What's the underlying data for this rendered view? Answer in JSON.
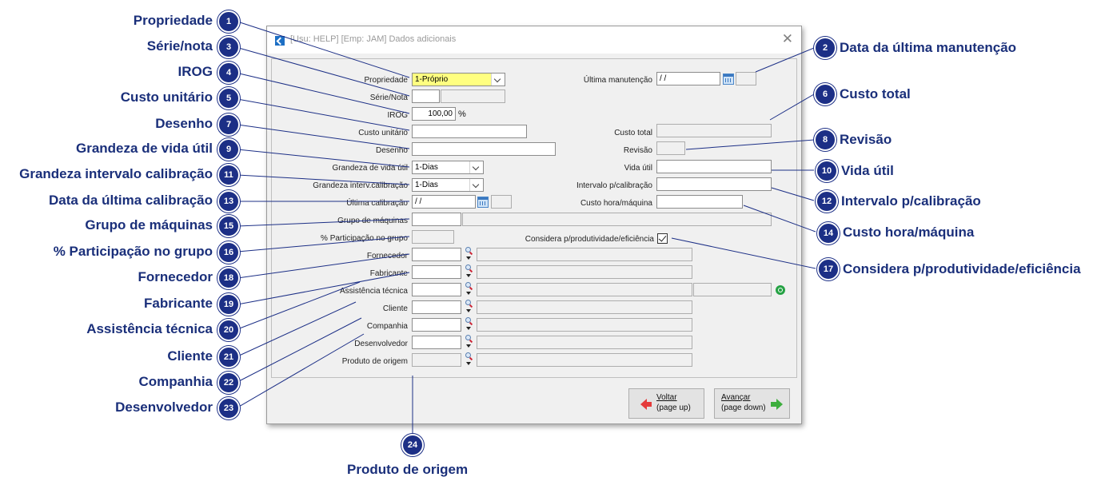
{
  "window": {
    "title": "[Usu: HELP] [Emp: JAM] Dados adicionais"
  },
  "form": {
    "propriedade": {
      "label": "Propriedade",
      "value": "1-Próprio"
    },
    "serie_nota": {
      "label": "Série/Nota",
      "value": "",
      "value2": ""
    },
    "irog": {
      "label": "IROG",
      "value": "100,00",
      "unit": "%"
    },
    "custo_unitario": {
      "label": "Custo unitário",
      "value": ""
    },
    "desenho": {
      "label": "Desenho",
      "value": ""
    },
    "grandeza_vida_util": {
      "label": "Grandeza de vida útil",
      "value": "1-Dias"
    },
    "grandeza_interv": {
      "label": "Grandeza interv.calibração",
      "value": "1-Dias"
    },
    "ultima_calibracao": {
      "label": "Última calibração",
      "value": " / /"
    },
    "grupo_maquinas": {
      "label": "Grupo de máquinas",
      "value": "",
      "desc": ""
    },
    "participacao_grupo": {
      "label": "% Participação no grupo",
      "value": ""
    },
    "fornecedor": {
      "label": "Fornecedor",
      "value": "",
      "desc": ""
    },
    "fabricante": {
      "label": "Fabricante",
      "value": "",
      "desc": ""
    },
    "assistencia_tecnica": {
      "label": "Assistência técnica",
      "value": "",
      "desc": "",
      "phone": ""
    },
    "cliente": {
      "label": "Cliente",
      "value": "",
      "desc": ""
    },
    "companhia": {
      "label": "Companhia",
      "value": "",
      "desc": ""
    },
    "desenvolvedor": {
      "label": "Desenvolvedor",
      "value": "",
      "desc": ""
    },
    "produto_origem": {
      "label": "Produto de origem",
      "value": "",
      "desc": ""
    },
    "ultima_manutencao": {
      "label": "Última manutenção",
      "value": " / /"
    },
    "custo_total": {
      "label": "Custo total",
      "value": ""
    },
    "revisao": {
      "label": "Revisão",
      "value": ""
    },
    "vida_util": {
      "label": "Vida útil",
      "value": ""
    },
    "intervalo_calibracao": {
      "label": "Intervalo p/calibração",
      "value": ""
    },
    "custo_hora_maquina": {
      "label": "Custo hora/máquina",
      "value": ""
    },
    "considera_produtividade": {
      "label": "Considera p/produtividade/eficiência",
      "checked": true
    }
  },
  "buttons": {
    "voltar": {
      "line1": "Voltar",
      "line2": "(page up)"
    },
    "avancar": {
      "line1": "Avançar",
      "line2": "(page down)"
    }
  },
  "annotations": {
    "a1": {
      "num": "1",
      "text": "Propriedade"
    },
    "a2": {
      "num": "2",
      "text": "Data da última manutenção"
    },
    "a3": {
      "num": "3",
      "text": "Série/nota"
    },
    "a4": {
      "num": "4",
      "text": "IROG"
    },
    "a5": {
      "num": "5",
      "text": "Custo unitário"
    },
    "a6": {
      "num": "6",
      "text": "Custo total"
    },
    "a7": {
      "num": "7",
      "text": "Desenho"
    },
    "a8": {
      "num": "8",
      "text": "Revisão"
    },
    "a9": {
      "num": "9",
      "text": "Grandeza de vida útil"
    },
    "a10": {
      "num": "10",
      "text": "Vida útil"
    },
    "a11": {
      "num": "11",
      "text": "Grandeza intervalo calibração"
    },
    "a12": {
      "num": "12",
      "text": "Intervalo p/calibração"
    },
    "a13": {
      "num": "13",
      "text": "Data da última calibração"
    },
    "a14": {
      "num": "14",
      "text": "Custo hora/máquina"
    },
    "a15": {
      "num": "15",
      "text": "Grupo de máquinas"
    },
    "a16": {
      "num": "16",
      "text": "% Participação no grupo"
    },
    "a17": {
      "num": "17",
      "text": "Considera p/produtividade/eficiência"
    },
    "a18": {
      "num": "18",
      "text": "Fornecedor"
    },
    "a19": {
      "num": "19",
      "text": "Fabricante"
    },
    "a20": {
      "num": "20",
      "text": "Assistência técnica"
    },
    "a21": {
      "num": "21",
      "text": "Cliente"
    },
    "a22": {
      "num": "22",
      "text": "Companhia"
    },
    "a23": {
      "num": "23",
      "text": "Desenvolvedor"
    },
    "a24": {
      "num": "24",
      "text": "Produto de origem"
    }
  },
  "colors": {
    "annotation": "#1c2f86",
    "required_field": "#ffff80"
  }
}
